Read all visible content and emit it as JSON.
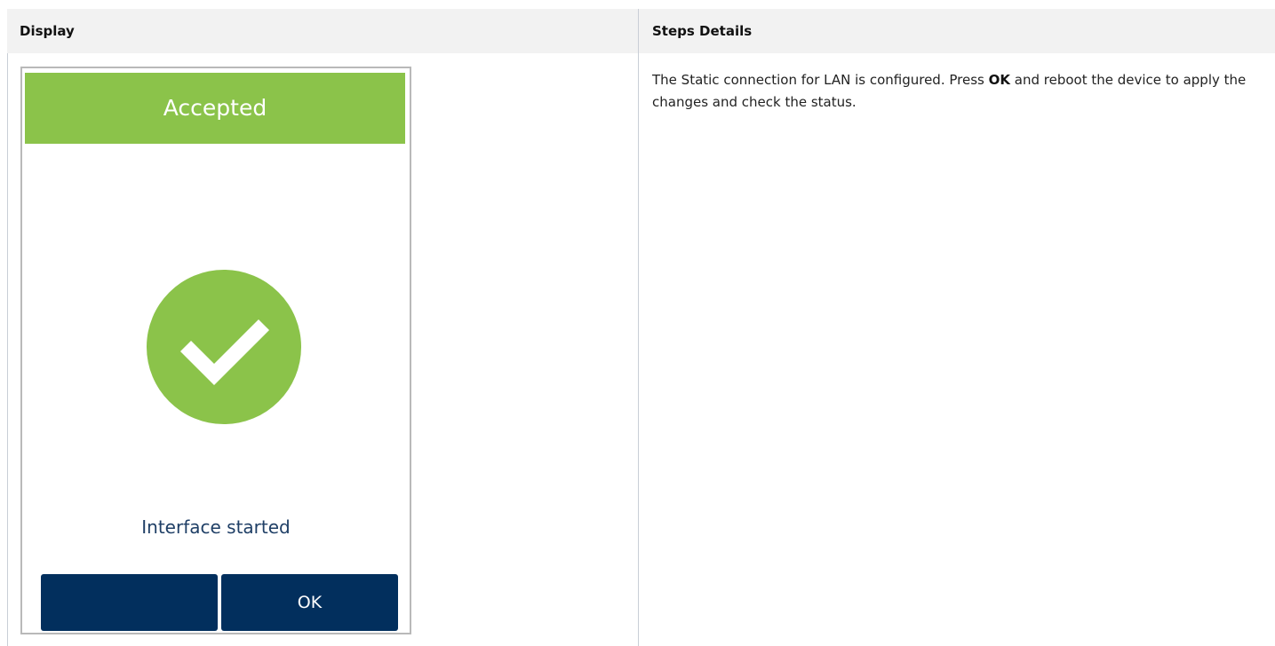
{
  "table": {
    "headers": {
      "display": "Display",
      "steps": "Steps Details"
    }
  },
  "device": {
    "header_title": "Accepted",
    "header_color": "#8bc34a",
    "icon": "check-circle-icon",
    "status_text": "Interface started",
    "softkeys": {
      "left_label": "",
      "right_label": "OK"
    },
    "softkey_color": "#022f5d"
  },
  "steps": {
    "text_before": "The Static connection for LAN is configured. Press ",
    "bold": "OK",
    "text_after": " and reboot the device to apply the changes and check the status."
  }
}
